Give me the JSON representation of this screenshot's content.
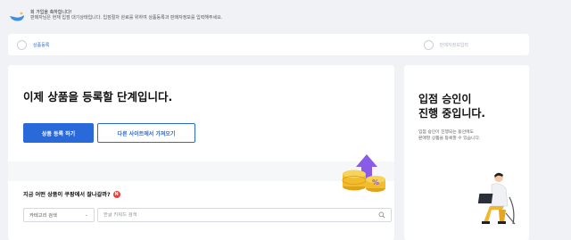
{
  "banner": {
    "line1": "회 가입을 축하합니다!",
    "line2": "판매자님은 현재 입점 대기상태입니다. 입점절차 완료를 위하여 상품등록과 판매자정보를 입력해주세요."
  },
  "steps": [
    {
      "label": "상품등록",
      "state": "active"
    },
    {
      "label": "판매자정보입력",
      "state": "inactive"
    }
  ],
  "main": {
    "headline": "이제 상품을 등록할 단계입니다.",
    "primary_button": "상품 등록 하기",
    "secondary_button": "다른 사이트에서 가져오기",
    "question": "지금 어떤 상품이 쿠팡에서 잘나갈까?",
    "new_badge": "N",
    "category_select": "카테고리 검색",
    "search_placeholder": "한글 키워드 검색"
  },
  "side": {
    "title_line1": "입점 승인이",
    "title_line2": "진행 중입니다.",
    "desc_line1": "입점 승인이 진행되는 동안에도",
    "desc_line2": "판매할 상품을 등록할 수 있습니다."
  },
  "colors": {
    "accent": "#2a69d9",
    "background": "#f1f2f5",
    "badge": "#e8403a"
  }
}
